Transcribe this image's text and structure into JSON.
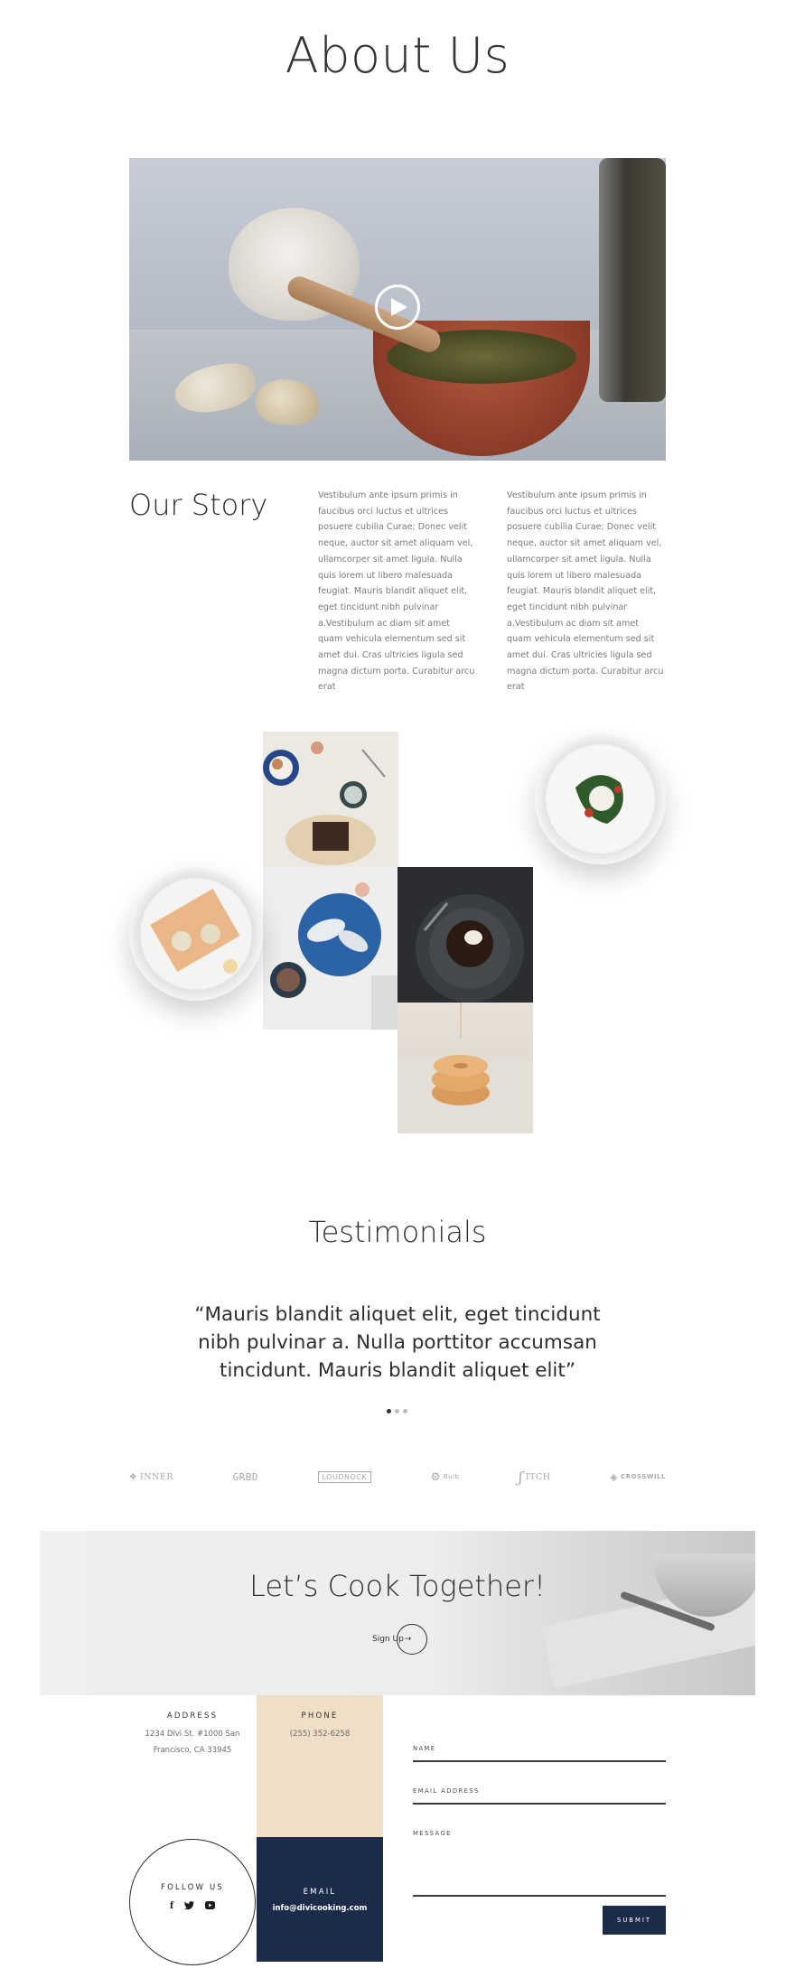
{
  "page": {
    "title": "About Us"
  },
  "hero": {
    "media": "video-thumbnail",
    "play_icon": "play-icon"
  },
  "story": {
    "title": "Our Story",
    "col1": "Vestibulum ante ipsum primis in faucibus orci luctus et ultrices posuere cubilia Curae; Donec velit neque, auctor sit amet aliquam vel, ullamcorper sit amet ligula. Nulla quis lorem ut libero malesuada feugiat. Mauris blandit aliquet elit, eget tincidunt nibh pulvinar a.Vestibulum ac diam sit amet quam vehicula elementum sed sit amet dui. Cras ultricies ligula sed magna dictum porta. Curabitur arcu erat",
    "col2": "Vestibulum ante ipsum primis in faucibus orci luctus et ultrices posuere cubilia Curae; Donec velit neque, auctor sit amet aliquam vel, ullamcorper sit amet ligula. Nulla quis lorem ut libero malesuada feugiat. Mauris blandit aliquet elit, eget tincidunt nibh pulvinar a.Vestibulum ac diam sit amet quam vehicula elementum sed sit amet dui. Cras ultricies ligula sed magna dictum porta. Curabitur arcu erat"
  },
  "testimonials": {
    "title": "Testimonials",
    "quote": "“Mauris blandit aliquet elit, eget tincidunt nibh pulvinar a. Nulla porttitor accumsan tincidunt. Mauris blandit aliquet elit”",
    "slides": 3,
    "active_slide": 1
  },
  "logos": [
    {
      "name": "INNER",
      "icon": "diamond-cluster-icon"
    },
    {
      "name": "GRBD",
      "icon": "none"
    },
    {
      "name": "LOUDNOCK",
      "icon": "speech-bubble-icon"
    },
    {
      "name": "Bulb",
      "icon": "gear-icon"
    },
    {
      "name": "ITCH",
      "icon": "hook-icon"
    },
    {
      "name": "CROSSWILL",
      "icon": "diamond-icon"
    }
  ],
  "cta": {
    "title": "Let’s Cook Together!",
    "button_label": "Sign Up",
    "arrow_icon": "arrow-right-icon"
  },
  "contact": {
    "address_label": "ADDRESS",
    "address_value": "1234 Divi St. #1000 San Francisco, CA 33945",
    "phone_label": "PHONE",
    "phone_value": "(255) 352-6258",
    "follow_label": "FOLLOW US",
    "social": [
      "facebook-icon",
      "twitter-icon",
      "youtube-icon"
    ],
    "email_label": "EMAIL",
    "email_value": "info@divicooking.com"
  },
  "form": {
    "name_label": "NAME",
    "email_label": "EMAIL ADDRESS",
    "message_label": "MESSAGE",
    "submit_label": "SUBMIT"
  },
  "colors": {
    "navy": "#1c2b4a",
    "sand": "#f0dfc6",
    "text": "#2e2e2e"
  }
}
